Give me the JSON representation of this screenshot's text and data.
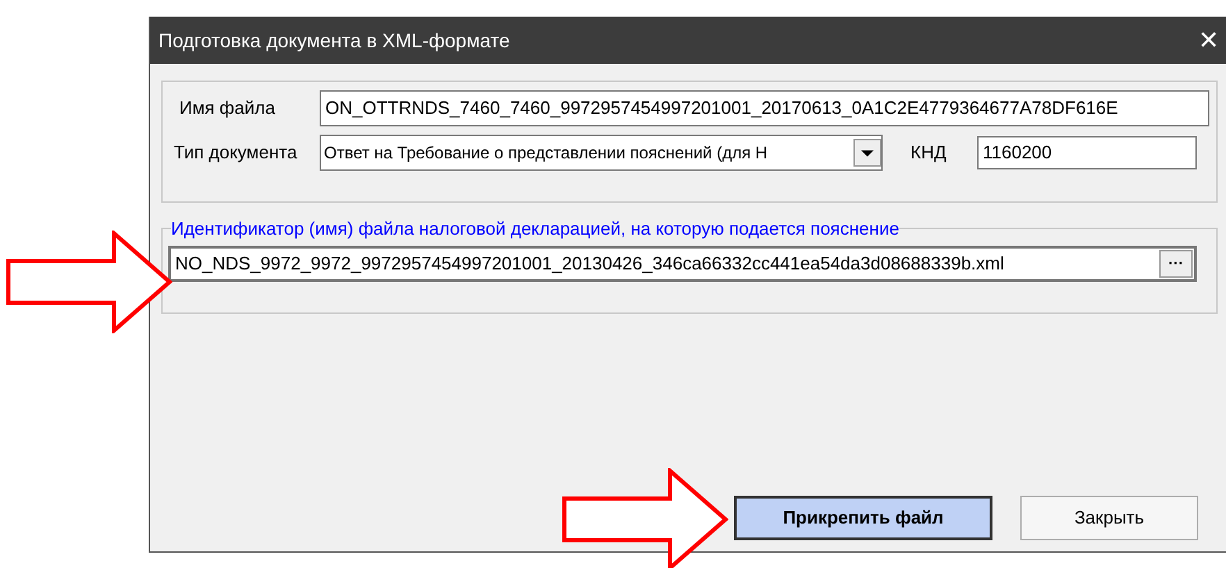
{
  "window": {
    "title": "Подготовка документа в XML-формате",
    "close": "✕"
  },
  "file_name": {
    "label": "Имя файла",
    "value": "ON_OTTRNDS_7460_7460_9972957454997201001_20170613_0A1C2E4779364677A78DF616E"
  },
  "doc_type": {
    "label": "Тип документа",
    "value": "Ответ на Требование о представлении пояснений (для Н"
  },
  "knd": {
    "label": "КНД",
    "value": "1160200"
  },
  "declaration": {
    "legend": "Идентификатор (имя) файла налоговой декларацией, на которую подается пояснение",
    "value": "NO_NDS_9972_9972_9972957454997201001_20130426_346ca66332cc441ea54da3d08688339b.xml",
    "browse": "···"
  },
  "buttons": [
    {
      "label": "Прикрепить файл",
      "kind": "primary"
    },
    {
      "label": "Закрыть",
      "kind": "normal"
    }
  ]
}
